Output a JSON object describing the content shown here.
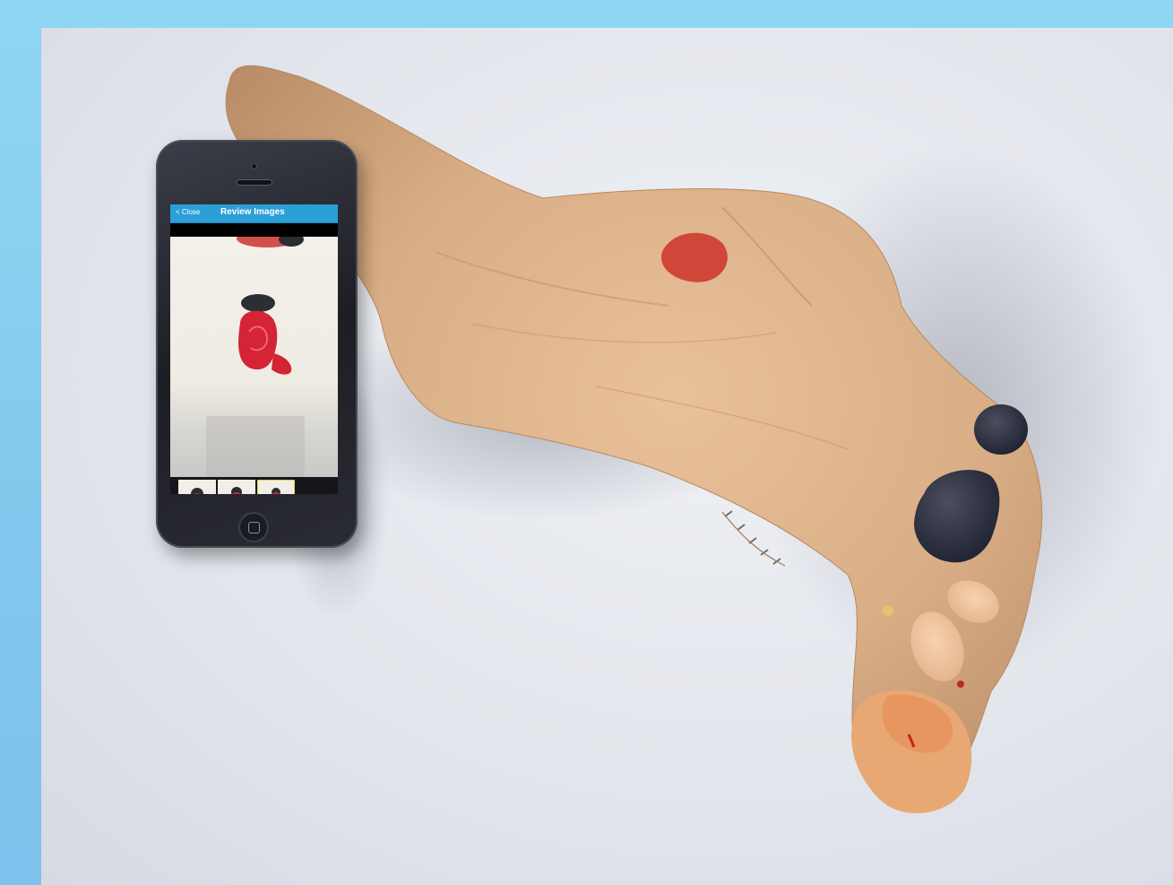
{
  "frame": {
    "background_color": "#8fd6f3",
    "photo_background_color": "#e6e8ee"
  },
  "phone": {
    "nav_bar": {
      "close_label": "< Close",
      "title": "Review Images",
      "color": "#2a9fd8"
    },
    "thumbnails_count": 3,
    "selected_thumbnail": 3
  },
  "icons": {
    "home_button": "home-button-icon",
    "back": "chevron-left-icon"
  }
}
